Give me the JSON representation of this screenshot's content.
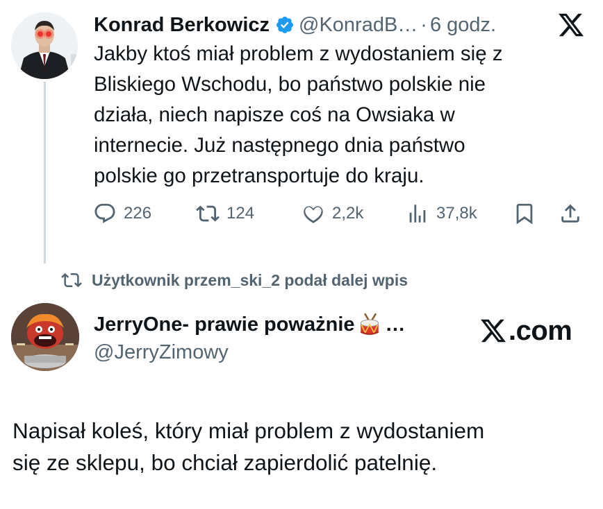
{
  "tweet1": {
    "name": "Konrad Berkowicz",
    "handle": "@KonradB…",
    "separator": "·",
    "time": "6 godz.",
    "text_lines": [
      "Jakby ktoś miał problem z wydostaniem się z",
      "Bliskiego Wschodu, bo państwo polskie nie",
      "działa, niech napisze coś na Owsiaka w",
      "internecie. Już następnego dnia państwo",
      "polskie go przetransportuje do kraju."
    ],
    "stats": {
      "replies": "226",
      "reposts": "124",
      "likes": "2,2k",
      "views": "37,8k"
    },
    "icons": {
      "verified": "verified-badge-icon",
      "platform": "x-logo-icon",
      "reply": "reply-icon",
      "repost": "repost-icon",
      "like": "heart-icon",
      "views": "views-icon",
      "bookmark": "bookmark-icon",
      "share": "share-icon"
    }
  },
  "repost_notice": {
    "text": "Użytkownik przem_ski_2 podał dalej wpis"
  },
  "tweet2": {
    "name": "JerryOne- prawie poważnie",
    "ellipsis": "…",
    "handle": "@JerryZimowy",
    "branding": ".com",
    "text_lines": [
      "Napisał koleś, który miał problem z wydostaniem",
      "się ze sklepu, bo chciał zapierdolić patelnię."
    ]
  },
  "colors": {
    "text": "#0f1419",
    "secondary": "#536471",
    "verified_blue": "#1d9bf0",
    "thread_line": "#cfd9de"
  }
}
